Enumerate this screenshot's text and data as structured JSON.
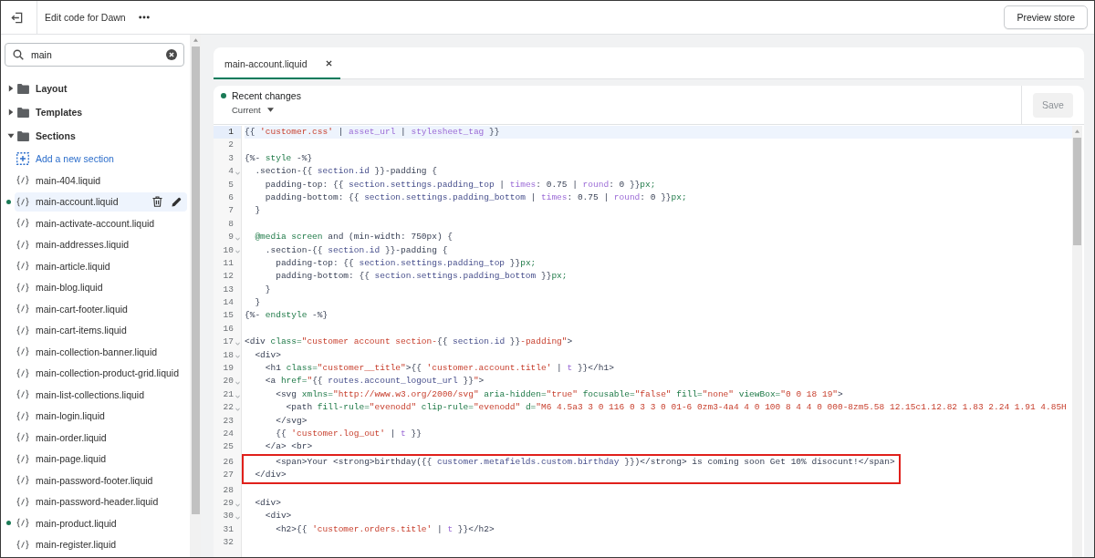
{
  "topbar": {
    "title": "Edit code for Dawn",
    "preview_button": "Preview store"
  },
  "sidebar": {
    "search": {
      "value": "main"
    },
    "tree": [
      {
        "label": "Layout",
        "expanded": false
      },
      {
        "label": "Templates",
        "expanded": false
      },
      {
        "label": "Sections",
        "expanded": true,
        "add_link": "Add a new section",
        "children": [
          {
            "label": "main-404.liquid",
            "selected": false,
            "modified": false
          },
          {
            "label": "main-account.liquid",
            "selected": true,
            "modified": true
          },
          {
            "label": "main-activate-account.liquid",
            "selected": false,
            "modified": false
          },
          {
            "label": "main-addresses.liquid",
            "selected": false,
            "modified": false
          },
          {
            "label": "main-article.liquid",
            "selected": false,
            "modified": false
          },
          {
            "label": "main-blog.liquid",
            "selected": false,
            "modified": false
          },
          {
            "label": "main-cart-footer.liquid",
            "selected": false,
            "modified": false
          },
          {
            "label": "main-cart-items.liquid",
            "selected": false,
            "modified": false
          },
          {
            "label": "main-collection-banner.liquid",
            "selected": false,
            "modified": false
          },
          {
            "label": "main-collection-product-grid.liquid",
            "selected": false,
            "modified": false
          },
          {
            "label": "main-list-collections.liquid",
            "selected": false,
            "modified": false
          },
          {
            "label": "main-login.liquid",
            "selected": false,
            "modified": false
          },
          {
            "label": "main-order.liquid",
            "selected": false,
            "modified": false
          },
          {
            "label": "main-page.liquid",
            "selected": false,
            "modified": false
          },
          {
            "label": "main-password-footer.liquid",
            "selected": false,
            "modified": false
          },
          {
            "label": "main-password-header.liquid",
            "selected": false,
            "modified": false
          },
          {
            "label": "main-product.liquid",
            "selected": false,
            "modified": true
          },
          {
            "label": "main-register.liquid",
            "selected": false,
            "modified": false
          }
        ]
      }
    ]
  },
  "editor": {
    "tabs": [
      {
        "label": "main-account.liquid",
        "selected": true
      }
    ],
    "history": {
      "status": "Recent changes",
      "version": "Current"
    },
    "save_button": {
      "label": "Save",
      "disabled": true
    },
    "lines": [
      {
        "number": "1",
        "current": true,
        "foldable": false,
        "highlighted": false,
        "tokens": [
          {
            "text": "{{ ",
            "kind": "plain"
          },
          {
            "text": "'customer.css'",
            "kind": "string"
          },
          {
            "text": " | ",
            "kind": "plain"
          },
          {
            "text": "asset_url",
            "kind": "filter"
          },
          {
            "text": " | ",
            "kind": "plain"
          },
          {
            "text": "stylesheet_tag",
            "kind": "filter"
          },
          {
            "text": " }}",
            "kind": "plain"
          }
        ]
      },
      {
        "number": "2",
        "current": false,
        "foldable": false,
        "highlighted": false
      },
      {
        "number": "3",
        "current": false,
        "foldable": false,
        "highlighted": false,
        "tokens": [
          {
            "text": "{%- ",
            "kind": "plain"
          },
          {
            "text": "style",
            "kind": "keyword"
          },
          {
            "text": " -%}",
            "kind": "plain"
          }
        ]
      },
      {
        "number": "4",
        "current": false,
        "foldable": true,
        "highlighted": false,
        "tokens": [
          {
            "text": "  .section-{{ ",
            "kind": "plain"
          },
          {
            "text": "section.id",
            "kind": "variable"
          },
          {
            "text": " }}-padding {",
            "kind": "plain"
          }
        ]
      },
      {
        "number": "5",
        "current": false,
        "foldable": false,
        "highlighted": false,
        "tokens": [
          {
            "text": "    padding-top: {{ ",
            "kind": "plain"
          },
          {
            "text": "section.settings.padding_top",
            "kind": "variable"
          },
          {
            "text": " | ",
            "kind": "plain"
          },
          {
            "text": "times",
            "kind": "filter"
          },
          {
            "text": ": 0.75 | ",
            "kind": "plain"
          },
          {
            "text": "round",
            "kind": "filter"
          },
          {
            "text": ": 0 }}",
            "kind": "plain"
          },
          {
            "text": "px;",
            "kind": "keyword"
          }
        ]
      },
      {
        "number": "6",
        "current": false,
        "foldable": false,
        "highlighted": false,
        "tokens": [
          {
            "text": "    padding-bottom: {{ ",
            "kind": "plain"
          },
          {
            "text": "section.settings.padding_bottom",
            "kind": "variable"
          },
          {
            "text": " | ",
            "kind": "plain"
          },
          {
            "text": "times",
            "kind": "filter"
          },
          {
            "text": ": 0.75 | ",
            "kind": "plain"
          },
          {
            "text": "round",
            "kind": "filter"
          },
          {
            "text": ": 0 }}",
            "kind": "plain"
          },
          {
            "text": "px;",
            "kind": "keyword"
          }
        ]
      },
      {
        "number": "7",
        "current": false,
        "foldable": false,
        "highlighted": false,
        "tokens": [
          {
            "text": "  }",
            "kind": "plain"
          }
        ]
      },
      {
        "number": "8",
        "current": false,
        "foldable": false,
        "highlighted": false
      },
      {
        "number": "9",
        "current": false,
        "foldable": true,
        "highlighted": false,
        "tokens": [
          {
            "text": "  @media screen",
            "kind": "keyword"
          },
          {
            "text": " and (min-width: 750px) {",
            "kind": "plain"
          }
        ]
      },
      {
        "number": "10",
        "current": false,
        "foldable": true,
        "highlighted": false,
        "tokens": [
          {
            "text": "    .section-{{ ",
            "kind": "plain"
          },
          {
            "text": "section.id",
            "kind": "variable"
          },
          {
            "text": " }}-padding {",
            "kind": "plain"
          }
        ]
      },
      {
        "number": "11",
        "current": false,
        "foldable": false,
        "highlighted": false,
        "tokens": [
          {
            "text": "      padding-top: {{ ",
            "kind": "plain"
          },
          {
            "text": "section.settings.padding_top",
            "kind": "variable"
          },
          {
            "text": " }}",
            "kind": "plain"
          },
          {
            "text": "px;",
            "kind": "keyword"
          }
        ]
      },
      {
        "number": "12",
        "current": false,
        "foldable": false,
        "highlighted": false,
        "tokens": [
          {
            "text": "      padding-bottom: {{ ",
            "kind": "plain"
          },
          {
            "text": "section.settings.padding_bottom",
            "kind": "variable"
          },
          {
            "text": " }}",
            "kind": "plain"
          },
          {
            "text": "px;",
            "kind": "keyword"
          }
        ]
      },
      {
        "number": "13",
        "current": false,
        "foldable": false,
        "highlighted": false,
        "tokens": [
          {
            "text": "    }",
            "kind": "plain"
          }
        ]
      },
      {
        "number": "14",
        "current": false,
        "foldable": false,
        "highlighted": false,
        "tokens": [
          {
            "text": "  }",
            "kind": "plain"
          }
        ]
      },
      {
        "number": "15",
        "current": false,
        "foldable": false,
        "highlighted": false,
        "tokens": [
          {
            "text": "{%- ",
            "kind": "plain"
          },
          {
            "text": "endstyle",
            "kind": "keyword"
          },
          {
            "text": " -%}",
            "kind": "plain"
          }
        ]
      },
      {
        "number": "16",
        "current": false,
        "foldable": false,
        "highlighted": false
      },
      {
        "number": "17",
        "current": false,
        "foldable": true,
        "highlighted": false,
        "tokens": [
          {
            "text": "<div ",
            "kind": "plain"
          },
          {
            "text": "class=",
            "kind": "keyword"
          },
          {
            "text": "\"customer account section-",
            "kind": "string"
          },
          {
            "text": "{{ ",
            "kind": "plain"
          },
          {
            "text": "section.id",
            "kind": "variable"
          },
          {
            "text": " }}",
            "kind": "plain"
          },
          {
            "text": "-padding\"",
            "kind": "string"
          },
          {
            "text": ">",
            "kind": "plain"
          }
        ]
      },
      {
        "number": "18",
        "current": false,
        "foldable": true,
        "highlighted": false,
        "tokens": [
          {
            "text": "  <div>",
            "kind": "plain"
          }
        ]
      },
      {
        "number": "19",
        "current": false,
        "foldable": false,
        "highlighted": false,
        "tokens": [
          {
            "text": "    <h1 ",
            "kind": "plain"
          },
          {
            "text": "class=",
            "kind": "keyword"
          },
          {
            "text": "\"customer__title\"",
            "kind": "string"
          },
          {
            "text": ">{{ ",
            "kind": "plain"
          },
          {
            "text": "'customer.account.title'",
            "kind": "string"
          },
          {
            "text": " | ",
            "kind": "plain"
          },
          {
            "text": "t",
            "kind": "filter"
          },
          {
            "text": " }}</h1>",
            "kind": "plain"
          }
        ]
      },
      {
        "number": "20",
        "current": false,
        "foldable": true,
        "highlighted": false,
        "tokens": [
          {
            "text": "    <a ",
            "kind": "plain"
          },
          {
            "text": "href=",
            "kind": "keyword"
          },
          {
            "text": "\"",
            "kind": "string"
          },
          {
            "text": "{{ ",
            "kind": "plain"
          },
          {
            "text": "routes.account_logout_url",
            "kind": "variable"
          },
          {
            "text": " }}",
            "kind": "plain"
          },
          {
            "text": "\"",
            "kind": "string"
          },
          {
            "text": ">",
            "kind": "plain"
          }
        ]
      },
      {
        "number": "21",
        "current": false,
        "foldable": true,
        "highlighted": false,
        "tokens": [
          {
            "text": "      <svg ",
            "kind": "plain"
          },
          {
            "text": "xmlns=",
            "kind": "keyword"
          },
          {
            "text": "\"http://www.w3.org/2000/svg\"",
            "kind": "string"
          },
          {
            "text": " aria-hidden=",
            "kind": "keyword"
          },
          {
            "text": "\"true\"",
            "kind": "string"
          },
          {
            "text": " focusable=",
            "kind": "keyword"
          },
          {
            "text": "\"false\"",
            "kind": "string"
          },
          {
            "text": " fill=",
            "kind": "keyword"
          },
          {
            "text": "\"none\"",
            "kind": "string"
          },
          {
            "text": " viewBox=",
            "kind": "keyword"
          },
          {
            "text": "\"0 0 18 19\"",
            "kind": "string"
          },
          {
            "text": ">",
            "kind": "plain"
          }
        ]
      },
      {
        "number": "22",
        "current": false,
        "foldable": true,
        "highlighted": false,
        "tokens": [
          {
            "text": "        <path ",
            "kind": "plain"
          },
          {
            "text": "fill-rule=",
            "kind": "keyword"
          },
          {
            "text": "\"evenodd\"",
            "kind": "string"
          },
          {
            "text": " clip-rule=",
            "kind": "keyword"
          },
          {
            "text": "\"evenodd\"",
            "kind": "string"
          },
          {
            "text": " d=",
            "kind": "keyword"
          },
          {
            "text": "\"M6 4.5a3 3 0 116 0 3 3 0 01-6 0zm3-4a4 4 0 100 8 4 4 0 000-8zm5.58 12.15c1.12.82 1.83 2.24 1.91 4.85H",
            "kind": "string"
          }
        ]
      },
      {
        "number": "23",
        "current": false,
        "foldable": false,
        "highlighted": false,
        "tokens": [
          {
            "text": "      </svg>",
            "kind": "plain"
          }
        ]
      },
      {
        "number": "24",
        "current": false,
        "foldable": false,
        "highlighted": false,
        "tokens": [
          {
            "text": "      {{ ",
            "kind": "plain"
          },
          {
            "text": "'customer.log_out'",
            "kind": "string"
          },
          {
            "text": " | ",
            "kind": "plain"
          },
          {
            "text": "t",
            "kind": "filter"
          },
          {
            "text": " }}",
            "kind": "plain"
          }
        ]
      },
      {
        "number": "25",
        "current": false,
        "foldable": false,
        "highlighted": false,
        "tokens": [
          {
            "text": "    </a> <br>",
            "kind": "plain"
          }
        ]
      },
      {
        "number": "26",
        "current": false,
        "foldable": false,
        "highlighted": true,
        "tokens": [
          {
            "text": "      <span>Your <strong>birthday({{ ",
            "kind": "plain"
          },
          {
            "text": "customer.metafields.custom.birthday",
            "kind": "variable"
          },
          {
            "text": " }})</strong> is coming soon Get 10% disocunt!</span>",
            "kind": "plain"
          }
        ]
      },
      {
        "number": "27",
        "current": false,
        "foldable": false,
        "highlighted": true,
        "tokens": [
          {
            "text": "  </div>",
            "kind": "plain"
          }
        ]
      },
      {
        "number": "28",
        "current": false,
        "foldable": false,
        "highlighted": false
      },
      {
        "number": "29",
        "current": false,
        "foldable": true,
        "highlighted": false,
        "tokens": [
          {
            "text": "  <div>",
            "kind": "plain"
          }
        ]
      },
      {
        "number": "30",
        "current": false,
        "foldable": true,
        "highlighted": false,
        "tokens": [
          {
            "text": "    <div>",
            "kind": "plain"
          }
        ]
      },
      {
        "number": "31",
        "current": false,
        "foldable": false,
        "highlighted": false,
        "tokens": [
          {
            "text": "      <h2>{{ ",
            "kind": "plain"
          },
          {
            "text": "'customer.orders.title'",
            "kind": "string"
          },
          {
            "text": " | ",
            "kind": "plain"
          },
          {
            "text": "t",
            "kind": "filter"
          },
          {
            "text": " }}</h2>",
            "kind": "plain"
          }
        ]
      },
      {
        "number": "32",
        "current": false,
        "foldable": false,
        "highlighted": false
      }
    ]
  }
}
